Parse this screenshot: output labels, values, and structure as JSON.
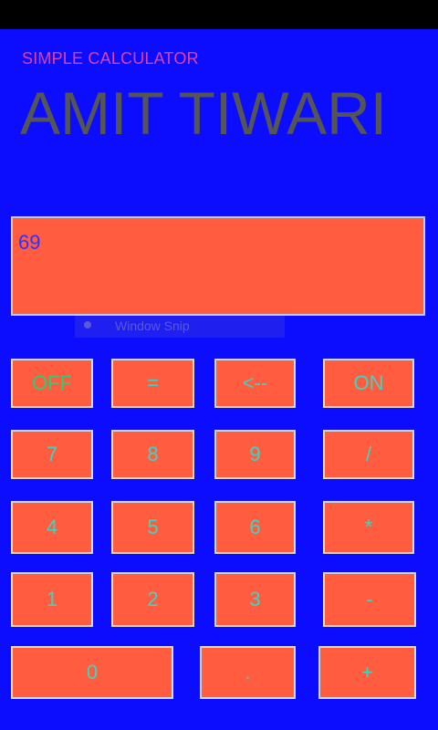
{
  "header": {
    "subtitle": "SIMPLE CALCULATOR",
    "title": "AMIT TIWARI"
  },
  "display": {
    "value": "69"
  },
  "snip": {
    "label": "Window Snip"
  },
  "keys": {
    "off": "OFF",
    "equals": "=",
    "backspace": "<--",
    "on": "ON",
    "seven": "7",
    "eight": "8",
    "nine": "9",
    "divide": "/",
    "four": "4",
    "five": "5",
    "six": "6",
    "multiply": "*",
    "one": "1",
    "two": "2",
    "three": "3",
    "minus": "-",
    "zero": "0",
    "dot": ".",
    "plus": "+"
  },
  "colors": {
    "background": "#0c0cff",
    "key": "#ff5c40",
    "key_text": "#3ad6c4",
    "title": "#555555",
    "subtitle": "#e040a8"
  }
}
